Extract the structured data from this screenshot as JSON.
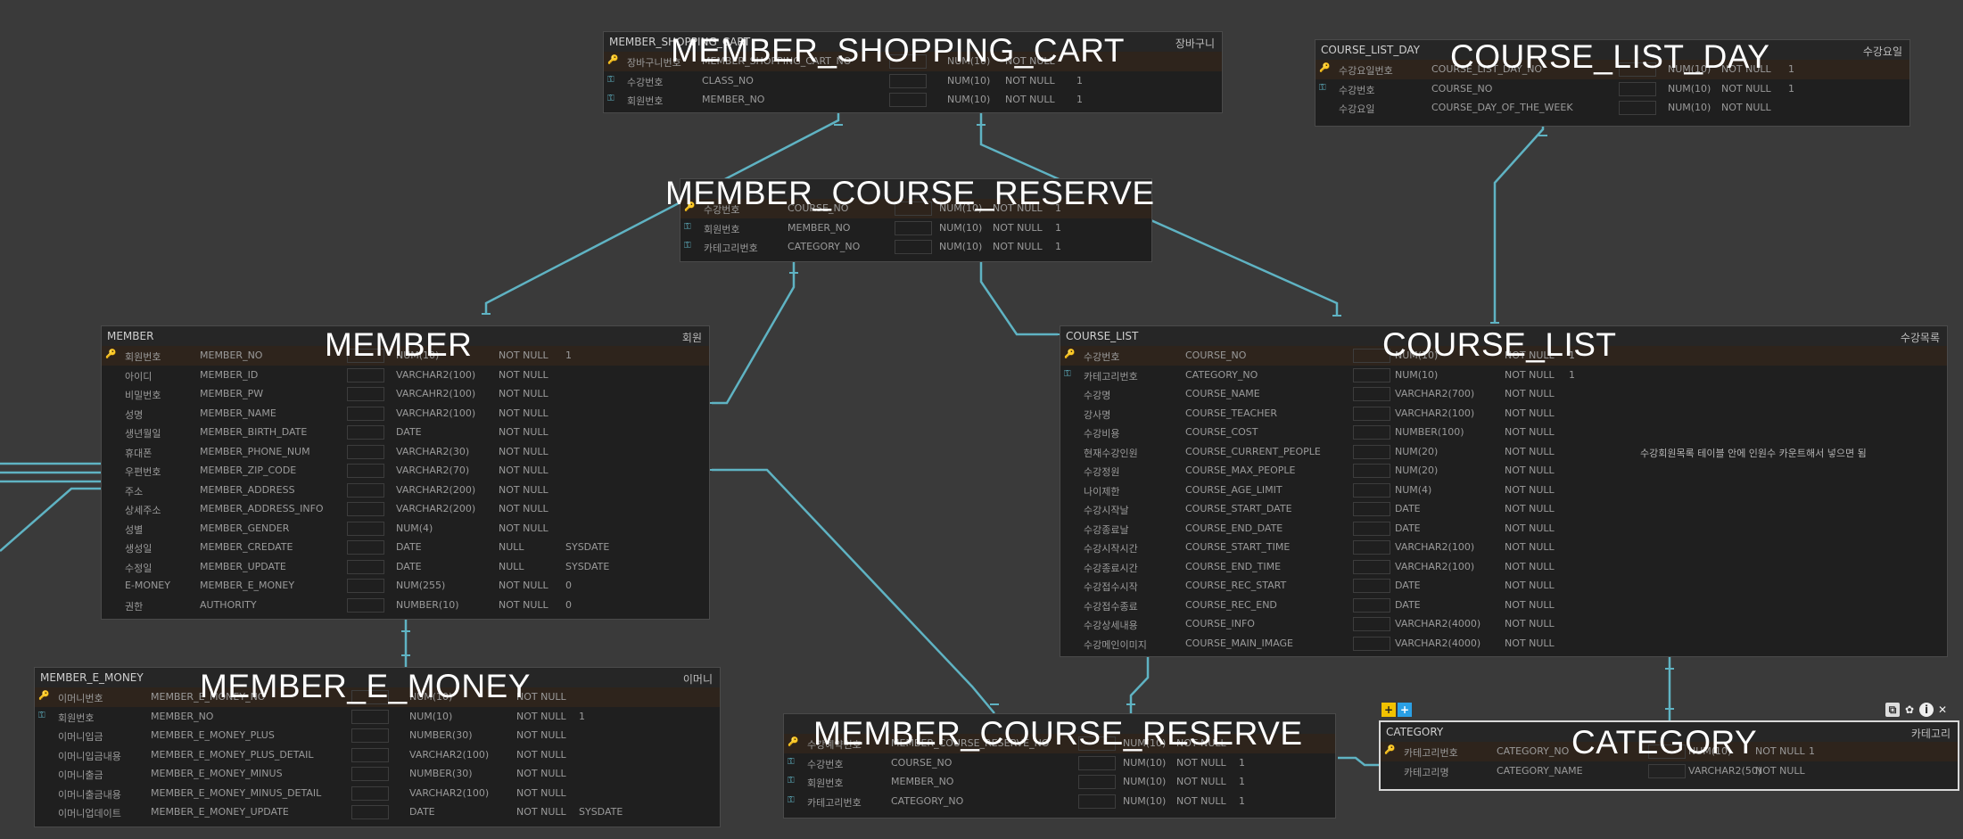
{
  "tables": [
    {
      "id": "member_shopping_cart",
      "title": "MEMBER_SHOPPING_CART",
      "caption": "MEMBER_SHOPPING_CART",
      "comment": "장바구니",
      "rows": [
        {
          "key": "pk",
          "logical": "장바구니번호",
          "physical": "MEMBER_SHOPPING_CART_NO",
          "type": "NUM(10)",
          "null": "NOT NULL",
          "default": ""
        },
        {
          "key": "fk",
          "logical": "수강번호",
          "physical": "CLASS_NO",
          "type": "NUM(10)",
          "null": "NOT NULL",
          "default": "1"
        },
        {
          "key": "fk",
          "logical": "회원번호",
          "physical": "MEMBER_NO",
          "type": "NUM(10)",
          "null": "NOT NULL",
          "default": "1"
        }
      ]
    },
    {
      "id": "course_list_day",
      "title": "COURSE_LIST_DAY",
      "caption": "COURSE_LIST_DAY",
      "comment": "수강요일",
      "rows": [
        {
          "key": "pk",
          "logical": "수강요일번호",
          "physical": "COURSE_LIST_DAY_NO",
          "type": "NUM(10)",
          "null": "NOT NULL",
          "default": "1"
        },
        {
          "key": "fk",
          "logical": "수강번호",
          "physical": "COURSE_NO",
          "type": "NUM(10)",
          "null": "NOT NULL",
          "default": "1"
        },
        {
          "key": "",
          "logical": "수강요일",
          "physical": "COURSE_DAY_OF_THE_WEEK",
          "type": "NUM(10)",
          "null": "NOT NULL",
          "default": ""
        }
      ]
    },
    {
      "id": "member_course_reserve_top",
      "title": "",
      "caption": "MEMBER_COURSE_RESERVE",
      "comment": "",
      "rows": [
        {
          "key": "pk",
          "logical": "수강번호",
          "physical": "COURSE_NO",
          "type": "NUM(10)",
          "null": "NOT NULL",
          "default": "1"
        },
        {
          "key": "fk",
          "logical": "회원번호",
          "physical": "MEMBER_NO",
          "type": "NUM(10)",
          "null": "NOT NULL",
          "default": "1"
        },
        {
          "key": "fk",
          "logical": "카테고리번호",
          "physical": "CATEGORY_NO",
          "type": "NUM(10)",
          "null": "NOT NULL",
          "default": "1"
        }
      ]
    },
    {
      "id": "member",
      "title": "MEMBER",
      "caption": "MEMBER",
      "comment": "회원",
      "rows": [
        {
          "key": "pk",
          "logical": "회원번호",
          "physical": "MEMBER_NO",
          "type": "NUM(10)",
          "null": "NOT NULL",
          "default": "1"
        },
        {
          "key": "",
          "logical": "아이디",
          "physical": "MEMBER_ID",
          "type": "VARCHAR2(100)",
          "null": "NOT NULL",
          "default": ""
        },
        {
          "key": "",
          "logical": "비밀번호",
          "physical": "MEMBER_PW",
          "type": "VARCAHR2(100)",
          "null": "NOT NULL",
          "default": ""
        },
        {
          "key": "",
          "logical": "성명",
          "physical": "MEMBER_NAME",
          "type": "VARCHAR2(100)",
          "null": "NOT NULL",
          "default": ""
        },
        {
          "key": "",
          "logical": "생년월일",
          "physical": "MEMBER_BIRTH_DATE",
          "type": "DATE",
          "null": "NOT NULL",
          "default": ""
        },
        {
          "key": "",
          "logical": "휴대폰",
          "physical": "MEMBER_PHONE_NUM",
          "type": "VARCHAR2(30)",
          "null": "NOT NULL",
          "default": ""
        },
        {
          "key": "",
          "logical": "우편번호",
          "physical": "MEMBER_ZIP_CODE",
          "type": "VARCHAR2(70)",
          "null": "NOT NULL",
          "default": ""
        },
        {
          "key": "",
          "logical": "주소",
          "physical": "MEMBER_ADDRESS",
          "type": "VARCHAR2(200)",
          "null": "NOT NULL",
          "default": ""
        },
        {
          "key": "",
          "logical": "상세주소",
          "physical": "MEMBER_ADDRESS_INFO",
          "type": "VARCHAR2(200)",
          "null": "NOT NULL",
          "default": ""
        },
        {
          "key": "",
          "logical": "성별",
          "physical": "MEMBER_GENDER",
          "type": "NUM(4)",
          "null": "NOT NULL",
          "default": ""
        },
        {
          "key": "",
          "logical": "생성일",
          "physical": "MEMBER_CREDATE",
          "type": "DATE",
          "null": "NULL",
          "default": "SYSDATE"
        },
        {
          "key": "",
          "logical": "수정일",
          "physical": "MEMBER_UPDATE",
          "type": "DATE",
          "null": "NULL",
          "default": "SYSDATE"
        },
        {
          "key": "",
          "logical": "E-MONEY",
          "physical": "MEMBER_E_MONEY",
          "type": "NUM(255)",
          "null": "NOT NULL",
          "default": "0"
        },
        {
          "key": "",
          "logical": "권한",
          "physical": "AUTHORITY",
          "type": "NUMBER(10)",
          "null": "NOT NULL",
          "default": "0"
        }
      ]
    },
    {
      "id": "course_list",
      "title": "COURSE_LIST",
      "caption": "COURSE_LIST",
      "comment": "수강목록",
      "rows": [
        {
          "key": "pk",
          "logical": "수강번호",
          "physical": "COURSE_NO",
          "type": "NUM(10)",
          "null": "NOT NULL",
          "default": "1",
          "comment": ""
        },
        {
          "key": "fk",
          "logical": "카테고리번호",
          "physical": "CATEGORY_NO",
          "type": "NUM(10)",
          "null": "NOT NULL",
          "default": "1",
          "comment": ""
        },
        {
          "key": "",
          "logical": "수강명",
          "physical": "COURSE_NAME",
          "type": "VARCHAR2(700)",
          "null": "NOT NULL",
          "default": "",
          "comment": ""
        },
        {
          "key": "",
          "logical": "강사명",
          "physical": "COURSE_TEACHER",
          "type": "VARCHAR2(100)",
          "null": "NOT NULL",
          "default": "",
          "comment": ""
        },
        {
          "key": "",
          "logical": "수강비용",
          "physical": "COURSE_COST",
          "type": "NUMBER(100)",
          "null": "NOT NULL",
          "default": "",
          "comment": ""
        },
        {
          "key": "",
          "logical": "현재수강인원",
          "physical": "COURSE_CURRENT_PEOPLE",
          "type": "NUM(20)",
          "null": "NOT NULL",
          "default": "",
          "comment": "수강회원목록 테이블 안에 인원수 카운트해서 넣으면 됨"
        },
        {
          "key": "",
          "logical": "수강정원",
          "physical": "COURSE_MAX_PEOPLE",
          "type": "NUM(20)",
          "null": "NOT NULL",
          "default": "",
          "comment": ""
        },
        {
          "key": "",
          "logical": "나이제한",
          "physical": "COURSE_AGE_LIMIT",
          "type": "NUM(4)",
          "null": "NOT NULL",
          "default": "",
          "comment": ""
        },
        {
          "key": "",
          "logical": "수강시작날",
          "physical": "COURSE_START_DATE",
          "type": "DATE",
          "null": "NOT NULL",
          "default": "",
          "comment": ""
        },
        {
          "key": "",
          "logical": "수강종료날",
          "physical": "COURSE_END_DATE",
          "type": "DATE",
          "null": "NOT NULL",
          "default": "",
          "comment": ""
        },
        {
          "key": "",
          "logical": "수강시작시간",
          "physical": "COURSE_START_TIME",
          "type": "VARCHAR2(100)",
          "null": "NOT NULL",
          "default": "",
          "comment": ""
        },
        {
          "key": "",
          "logical": "수강종료시간",
          "physical": "COURSE_END_TIME",
          "type": "VARCHAR2(100)",
          "null": "NOT NULL",
          "default": "",
          "comment": ""
        },
        {
          "key": "",
          "logical": "수강접수시작",
          "physical": "COURSE_REC_START",
          "type": "DATE",
          "null": "NOT NULL",
          "default": "",
          "comment": ""
        },
        {
          "key": "",
          "logical": "수강접수종료",
          "physical": "COURSE_REC_END",
          "type": "DATE",
          "null": "NOT NULL",
          "default": "",
          "comment": ""
        },
        {
          "key": "",
          "logical": "수강상세내용",
          "physical": "COURSE_INFO",
          "type": "VARCHAR2(4000)",
          "null": "NOT NULL",
          "default": "",
          "comment": ""
        },
        {
          "key": "",
          "logical": "수강메인이미지",
          "physical": "COURSE_MAIN_IMAGE",
          "type": "VARCHAR2(4000)",
          "null": "NOT NULL",
          "default": "",
          "comment": ""
        }
      ]
    },
    {
      "id": "member_e_money",
      "title": "MEMBER_E_MONEY",
      "caption": "MEMBER_E_MONEY",
      "comment": "이머니",
      "rows": [
        {
          "key": "pk",
          "logical": "이머니번호",
          "physical": "MEMBER_E_MONEY_NO",
          "type": "NUM(10)",
          "null": "NOT NULL",
          "default": ""
        },
        {
          "key": "fk",
          "logical": "회원번호",
          "physical": "MEMBER_NO",
          "type": "NUM(10)",
          "null": "NOT NULL",
          "default": "1"
        },
        {
          "key": "",
          "logical": "이머니입금",
          "physical": "MEMBER_E_MONEY_PLUS",
          "type": "NUMBER(30)",
          "null": "NOT NULL",
          "default": ""
        },
        {
          "key": "",
          "logical": "이머니입금내용",
          "physical": "MEMBER_E_MONEY_PLUS_DETAIL",
          "type": "VARCHAR2(100)",
          "null": "NOT NULL",
          "default": ""
        },
        {
          "key": "",
          "logical": "이머니출금",
          "physical": "MEMBER_E_MONEY_MINUS",
          "type": "NUMBER(30)",
          "null": "NOT NULL",
          "default": ""
        },
        {
          "key": "",
          "logical": "이머니출금내용",
          "physical": "MEMBER_E_MONEY_MINUS_DETAIL",
          "type": "VARCHAR2(100)",
          "null": "NOT NULL",
          "default": ""
        },
        {
          "key": "",
          "logical": "이머니업데이트",
          "physical": "MEMBER_E_MONEY_UPDATE",
          "type": "DATE",
          "null": "NOT NULL",
          "default": "SYSDATE"
        }
      ]
    },
    {
      "id": "member_course_reserve_bottom",
      "title": "",
      "caption": "MEMBER_COURSE_RESERVE",
      "comment": "",
      "rows": [
        {
          "key": "pk",
          "logical": "수강예약번호",
          "physical": "MEMBER_COURSE_RESERVE_NO",
          "type": "NUM(10)",
          "null": "NOT NULL",
          "default": ""
        },
        {
          "key": "fk",
          "logical": "수강번호",
          "physical": "COURSE_NO",
          "type": "NUM(10)",
          "null": "NOT NULL",
          "default": "1"
        },
        {
          "key": "fk",
          "logical": "회원번호",
          "physical": "MEMBER_NO",
          "type": "NUM(10)",
          "null": "NOT NULL",
          "default": "1"
        },
        {
          "key": "fk",
          "logical": "카테고리번호",
          "physical": "CATEGORY_NO",
          "type": "NUM(10)",
          "null": "NOT NULL",
          "default": "1"
        }
      ]
    },
    {
      "id": "category",
      "title": "CATEGORY",
      "caption": "CATEGORY",
      "comment": "카테고리",
      "rows": [
        {
          "key": "pk",
          "logical": "카테고리번호",
          "physical": "CATEGORY_NO",
          "type": "NUM(10)",
          "null": "NOT NULL",
          "default": "1"
        },
        {
          "key": "",
          "logical": "카테고리명",
          "physical": "CATEGORY_NAME",
          "type": "VARCHAR2(50)",
          "null": "NOT NULL",
          "default": ""
        }
      ]
    }
  ],
  "key_icons": {
    "pk": "🔑",
    "fk": "⚿"
  },
  "colors": {
    "link": "#5fb3c3",
    "pk_icon": "#e0b030",
    "fk_icon": "#5fb0c0",
    "canvas": "#3a3a3a"
  }
}
